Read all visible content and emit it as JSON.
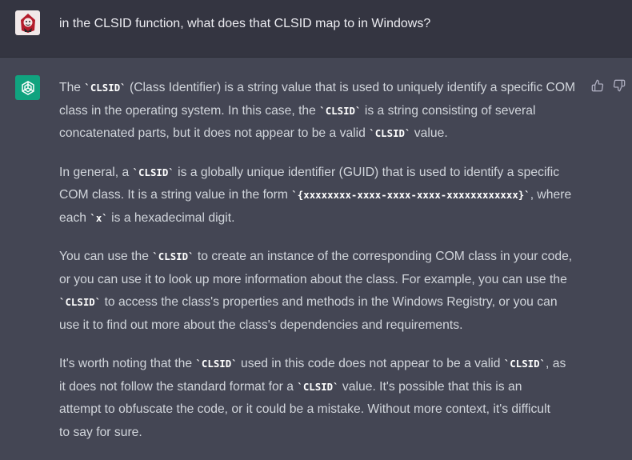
{
  "user": {
    "avatar_icon": "user-avatar-icon",
    "message": "in the CLSID function, what does that CLSID map to in Windows?"
  },
  "assistant": {
    "avatar_icon": "openai-logo-icon",
    "accent_color": "#10a37f",
    "feedback": {
      "thumbs_up_icon": "thumbs-up-icon",
      "thumbs_down_icon": "thumbs-down-icon"
    },
    "p1": {
      "a": "The ",
      "code1": "`CLSID`",
      "b": " (Class Identifier) is a string value that is used to uniquely identify a specific COM",
      "c": "class in the operating system. In this case, the ",
      "code2": "`CLSID`",
      "d": " is a string consisting of several",
      "e": "concatenated parts, but it does not appear to be a valid ",
      "code3": "`CLSID`",
      "f": " value."
    },
    "p2": {
      "a": "In general, a ",
      "code1": "`CLSID`",
      "b": " is a globally unique identifier (GUID) that is used to identify a specific",
      "c": "COM class. It is a string value in the form ",
      "code2": "`{xxxxxxxx-xxxx-xxxx-xxxx-xxxxxxxxxxxx}`",
      "d": ", where",
      "e": "each ",
      "code3": "`x`",
      "f": " is a hexadecimal digit."
    },
    "p3": {
      "a": "You can use the ",
      "code1": "`CLSID`",
      "b": " to create an instance of the corresponding COM class in your code,",
      "c": "or you can use it to look up more information about the class. For example, you can use the",
      "code2": "`CLSID`",
      "d": " to access the class's properties and methods in the Windows Registry, or you can",
      "e": "use it to find out more about the class's dependencies and requirements."
    },
    "p4": {
      "a": "It's worth noting that the ",
      "code1": "`CLSID`",
      "b": " used in this code does not appear to be a valid ",
      "code2": "`CLSID`",
      "c": ", as",
      "d": "it does not follow the standard format for a ",
      "code3": "`CLSID`",
      "e": " value. It's possible that this is an",
      "f": "attempt to obfuscate the code, or it could be a mistake. Without more context, it's difficult",
      "g": "to say for sure."
    }
  }
}
